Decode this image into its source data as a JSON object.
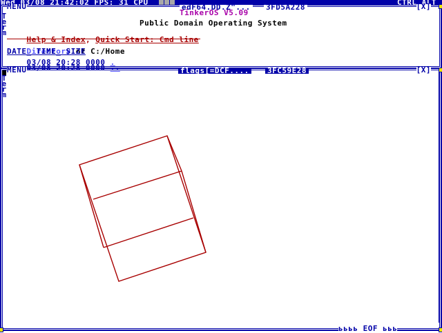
{
  "status_bar": {
    "datetime": "Wed 03/08 21:42:02 FPS: 31 CPU",
    "right": "CTRL ALT"
  },
  "editor_window": {
    "menu": "MENU",
    "title": "edF64.DD.Z\"...",
    "address": "3FD5A228",
    "close": "[X]",
    "side_label": [
      "T",
      "e",
      "r",
      "m"
    ],
    "os_name": "TinkerOS V5.09",
    "subtitle": "Public Domain Operating System",
    "help_link": "Help & Index",
    "separator": ",",
    "quick_start": "Quick Start: Cmd line",
    "directory_word": "Directory",
    "directory_path": "of C:/Home",
    "columns": "DATE_ TIME_ SIZE",
    "rows": [
      {
        "text": "03/08 20:28 0000",
        "link": "."
      },
      {
        "text": "03/08 20:28 0000",
        "link": ".."
      }
    ]
  },
  "graphics_window": {
    "menu": "MENU",
    "title": "flags[=DCF....",
    "address": "3FC59E28",
    "close": "[X]",
    "side_label": [
      "T",
      "e",
      "r",
      "m"
    ],
    "footer": "ьььь EOF ььь"
  },
  "colors": {
    "border": "#0000a8",
    "accent_red": "#a80000",
    "accent_purple": "#a800a8",
    "link": "#5454fc",
    "corner": "#e8e800"
  }
}
